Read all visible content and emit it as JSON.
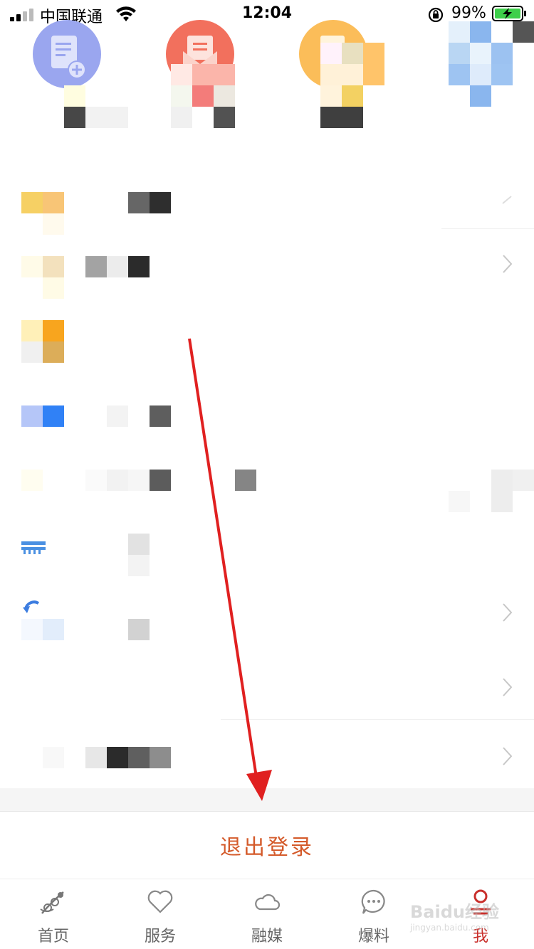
{
  "status_bar": {
    "carrier": "中国联通",
    "time": "12:04",
    "battery_percent": "99%"
  },
  "shortcuts": [
    {
      "icon": "new-document-icon",
      "color": "#9aa6ef"
    },
    {
      "icon": "mail-envelope-icon",
      "color": "#f2705d"
    },
    {
      "icon": "document-folder-icon",
      "color": "#fbbd59"
    },
    {
      "icon": "pixelated-blue-icon",
      "color": "#8ab6ee"
    }
  ],
  "menu": {
    "items": [
      {
        "icon": "yellow-orange-icon",
        "has_chevron": false
      },
      {
        "icon": "cream-icon",
        "has_chevron": true
      },
      {
        "icon": "orange-icon",
        "has_chevron": false
      },
      {
        "icon": "blue-icon",
        "has_chevron": false
      },
      {
        "icon": "pale-yellow-icon",
        "has_chevron": false
      },
      {
        "icon": "blue-stripes-icon",
        "has_chevron": false
      },
      {
        "icon": "blue-arrow-icon",
        "has_chevron": true
      },
      {
        "icon": "blank-icon",
        "has_chevron": true
      },
      {
        "icon": "blank-icon",
        "has_chevron": true
      }
    ]
  },
  "logout_button": {
    "label": "退出登录"
  },
  "tab_bar": {
    "tabs": [
      {
        "label": "首页",
        "icon": "home-icon",
        "active": false
      },
      {
        "label": "服务",
        "icon": "heart-icon",
        "active": false
      },
      {
        "label": "融媒",
        "icon": "cloud-icon",
        "active": false
      },
      {
        "label": "爆料",
        "icon": "chat-bubble-icon",
        "active": false
      },
      {
        "label": "我",
        "icon": "user-icon",
        "active": true
      }
    ]
  },
  "colors": {
    "accent_red": "#c9302c",
    "logout_text": "#d45a2a",
    "arrow_red": "#e02020"
  },
  "watermark": {
    "line1": "Baidu经验",
    "line2": "jingyan.baidu.com"
  }
}
